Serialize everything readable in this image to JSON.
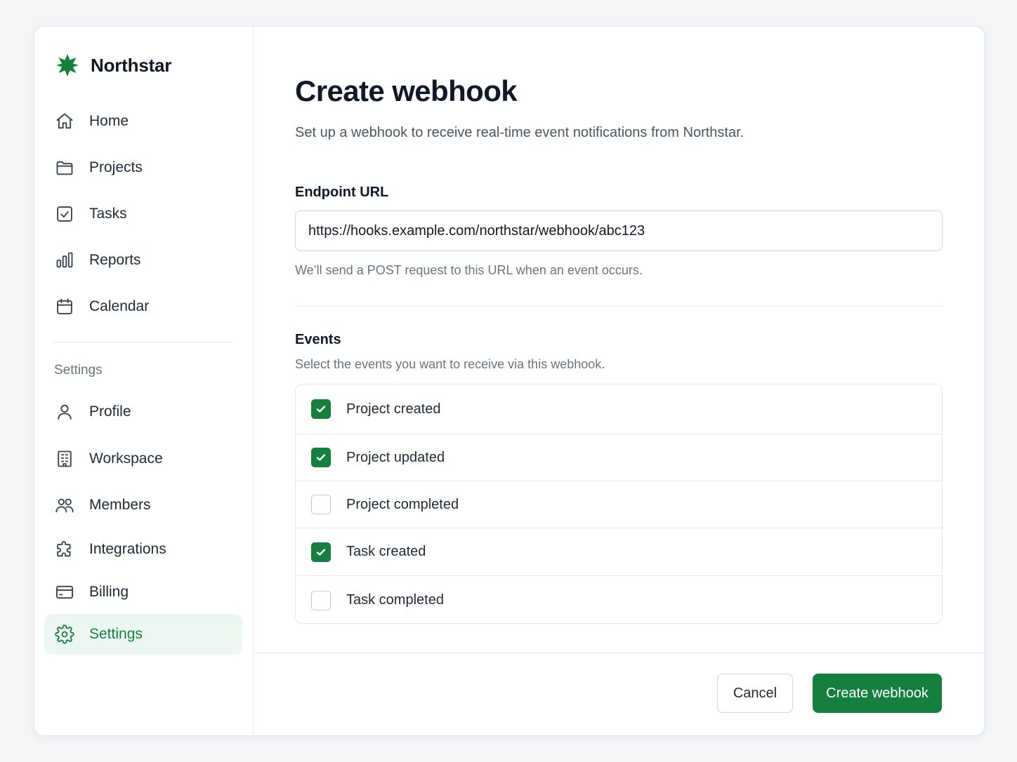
{
  "app": {
    "name": "Northstar",
    "logo_icon": "star-burst-icon",
    "accent_color": "#15803d"
  },
  "sidebar": {
    "items": [
      {
        "label": "Home",
        "icon": "home-icon"
      },
      {
        "label": "Projects",
        "icon": "folder-icon"
      },
      {
        "label": "Tasks",
        "icon": "checkbox-icon"
      },
      {
        "label": "Reports",
        "icon": "bar-chart-icon"
      },
      {
        "label": "Calendar",
        "icon": "calendar-icon"
      }
    ],
    "section_label": "Settings",
    "settings_items": [
      {
        "label": "Profile",
        "icon": "user-icon"
      },
      {
        "label": "Workspace",
        "icon": "building-icon"
      },
      {
        "label": "Members",
        "icon": "users-icon"
      },
      {
        "label": "Integrations",
        "icon": "puzzle-icon"
      },
      {
        "label": "Billing",
        "icon": "credit-card-icon"
      },
      {
        "label": "Settings",
        "icon": "gear-icon",
        "active": true
      }
    ]
  },
  "main": {
    "title": "Create webhook",
    "subtitle": "Set up a webhook to receive real-time event notifications from Northstar.",
    "endpoint": {
      "label": "Endpoint URL",
      "value": "https://hooks.example.com/northstar/webhook/abc123",
      "help": "We’ll send a POST request to this URL when an event occurs."
    },
    "events": {
      "label": "Events",
      "help": "Select the events you want to receive via this webhook.",
      "items": [
        {
          "label": "Project created",
          "checked": true
        },
        {
          "label": "Project updated",
          "checked": true
        },
        {
          "label": "Project completed",
          "checked": false
        },
        {
          "label": "Task created",
          "checked": true
        },
        {
          "label": "Task completed",
          "checked": false
        }
      ]
    },
    "actions": {
      "cancel_label": "Cancel",
      "submit_label": "Create webhook"
    }
  }
}
